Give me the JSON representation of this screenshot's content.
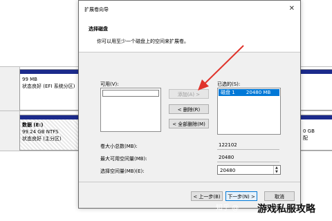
{
  "dialog": {
    "title": "扩展卷向导",
    "close_glyph": "✕",
    "header_title": "选择磁盘",
    "header_subtitle": "你可以用至少一个磁盘上的空间来扩展卷。",
    "available_label": "可用(V):",
    "selected_label": "已选的(S):",
    "add_button": "添加(A) >",
    "remove_button": "< 删除(R)",
    "remove_all_button": "< 全部删除(M)",
    "selected_items": [
      {
        "disk": "磁盘 1",
        "size": "20480 MB"
      }
    ],
    "total_volume_label": "卷大小总数(MB):",
    "total_volume_value": "122102",
    "max_available_label": "最大可用空间量(MB):",
    "max_available_value": "20480",
    "select_space_label": "选择空间量(MB)(E):",
    "select_space_value": "20480",
    "back_button": "< 上一步(B)",
    "next_button": "下一步(N) >",
    "cancel_button": "取消"
  },
  "background": {
    "partition1_size": "99 MB",
    "partition1_status": "状态良好 (EFI 系统分区)",
    "partition2_name": "数据 (E:)",
    "partition2_size": "99.24 GB NTFS",
    "partition2_status": "状态良好 (主分区)",
    "right_size": "0 GB",
    "right_status": "配"
  },
  "watermark": {
    "zhihu": "知乎 @",
    "site": "游戏私服攻略"
  },
  "colors": {
    "selection": "#0078d7",
    "arrow": "#e0332b",
    "disk_bar": "#1c2b8c"
  }
}
